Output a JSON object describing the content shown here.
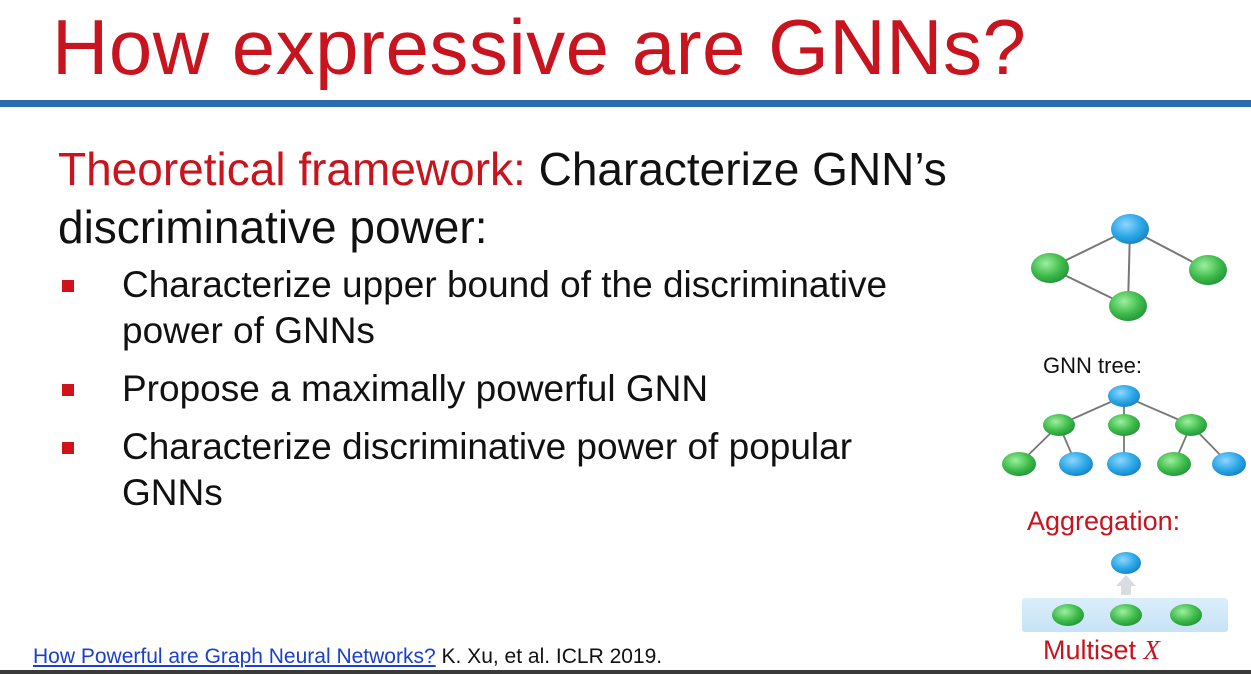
{
  "slide": {
    "title": "How expressive are GNNs?",
    "lead_accent": "Theoretical framework:",
    "lead_rest": " Characterize GNN’s discriminative power:",
    "bullets": [
      "Characterize upper bound of the discriminative power of GNNs",
      "Propose a maximally powerful GNN",
      "Characterize discriminative power of popular GNNs"
    ],
    "figure": {
      "gnn_tree_label": "GNN tree:",
      "aggregation_label": "Aggregation:",
      "multiset_label": "Multiset",
      "multiset_var": "X"
    },
    "citation": {
      "link_text": "How Powerful are Graph Neural Networks?",
      "rest": " K. Xu, et al. ICLR 2019."
    }
  },
  "colors": {
    "accent_red": "#c8141e",
    "rule_blue": "#2b6cb0",
    "node_blue": "#29a6e6",
    "node_green": "#3dbb4a",
    "link_blue": "#1a3fd1"
  }
}
